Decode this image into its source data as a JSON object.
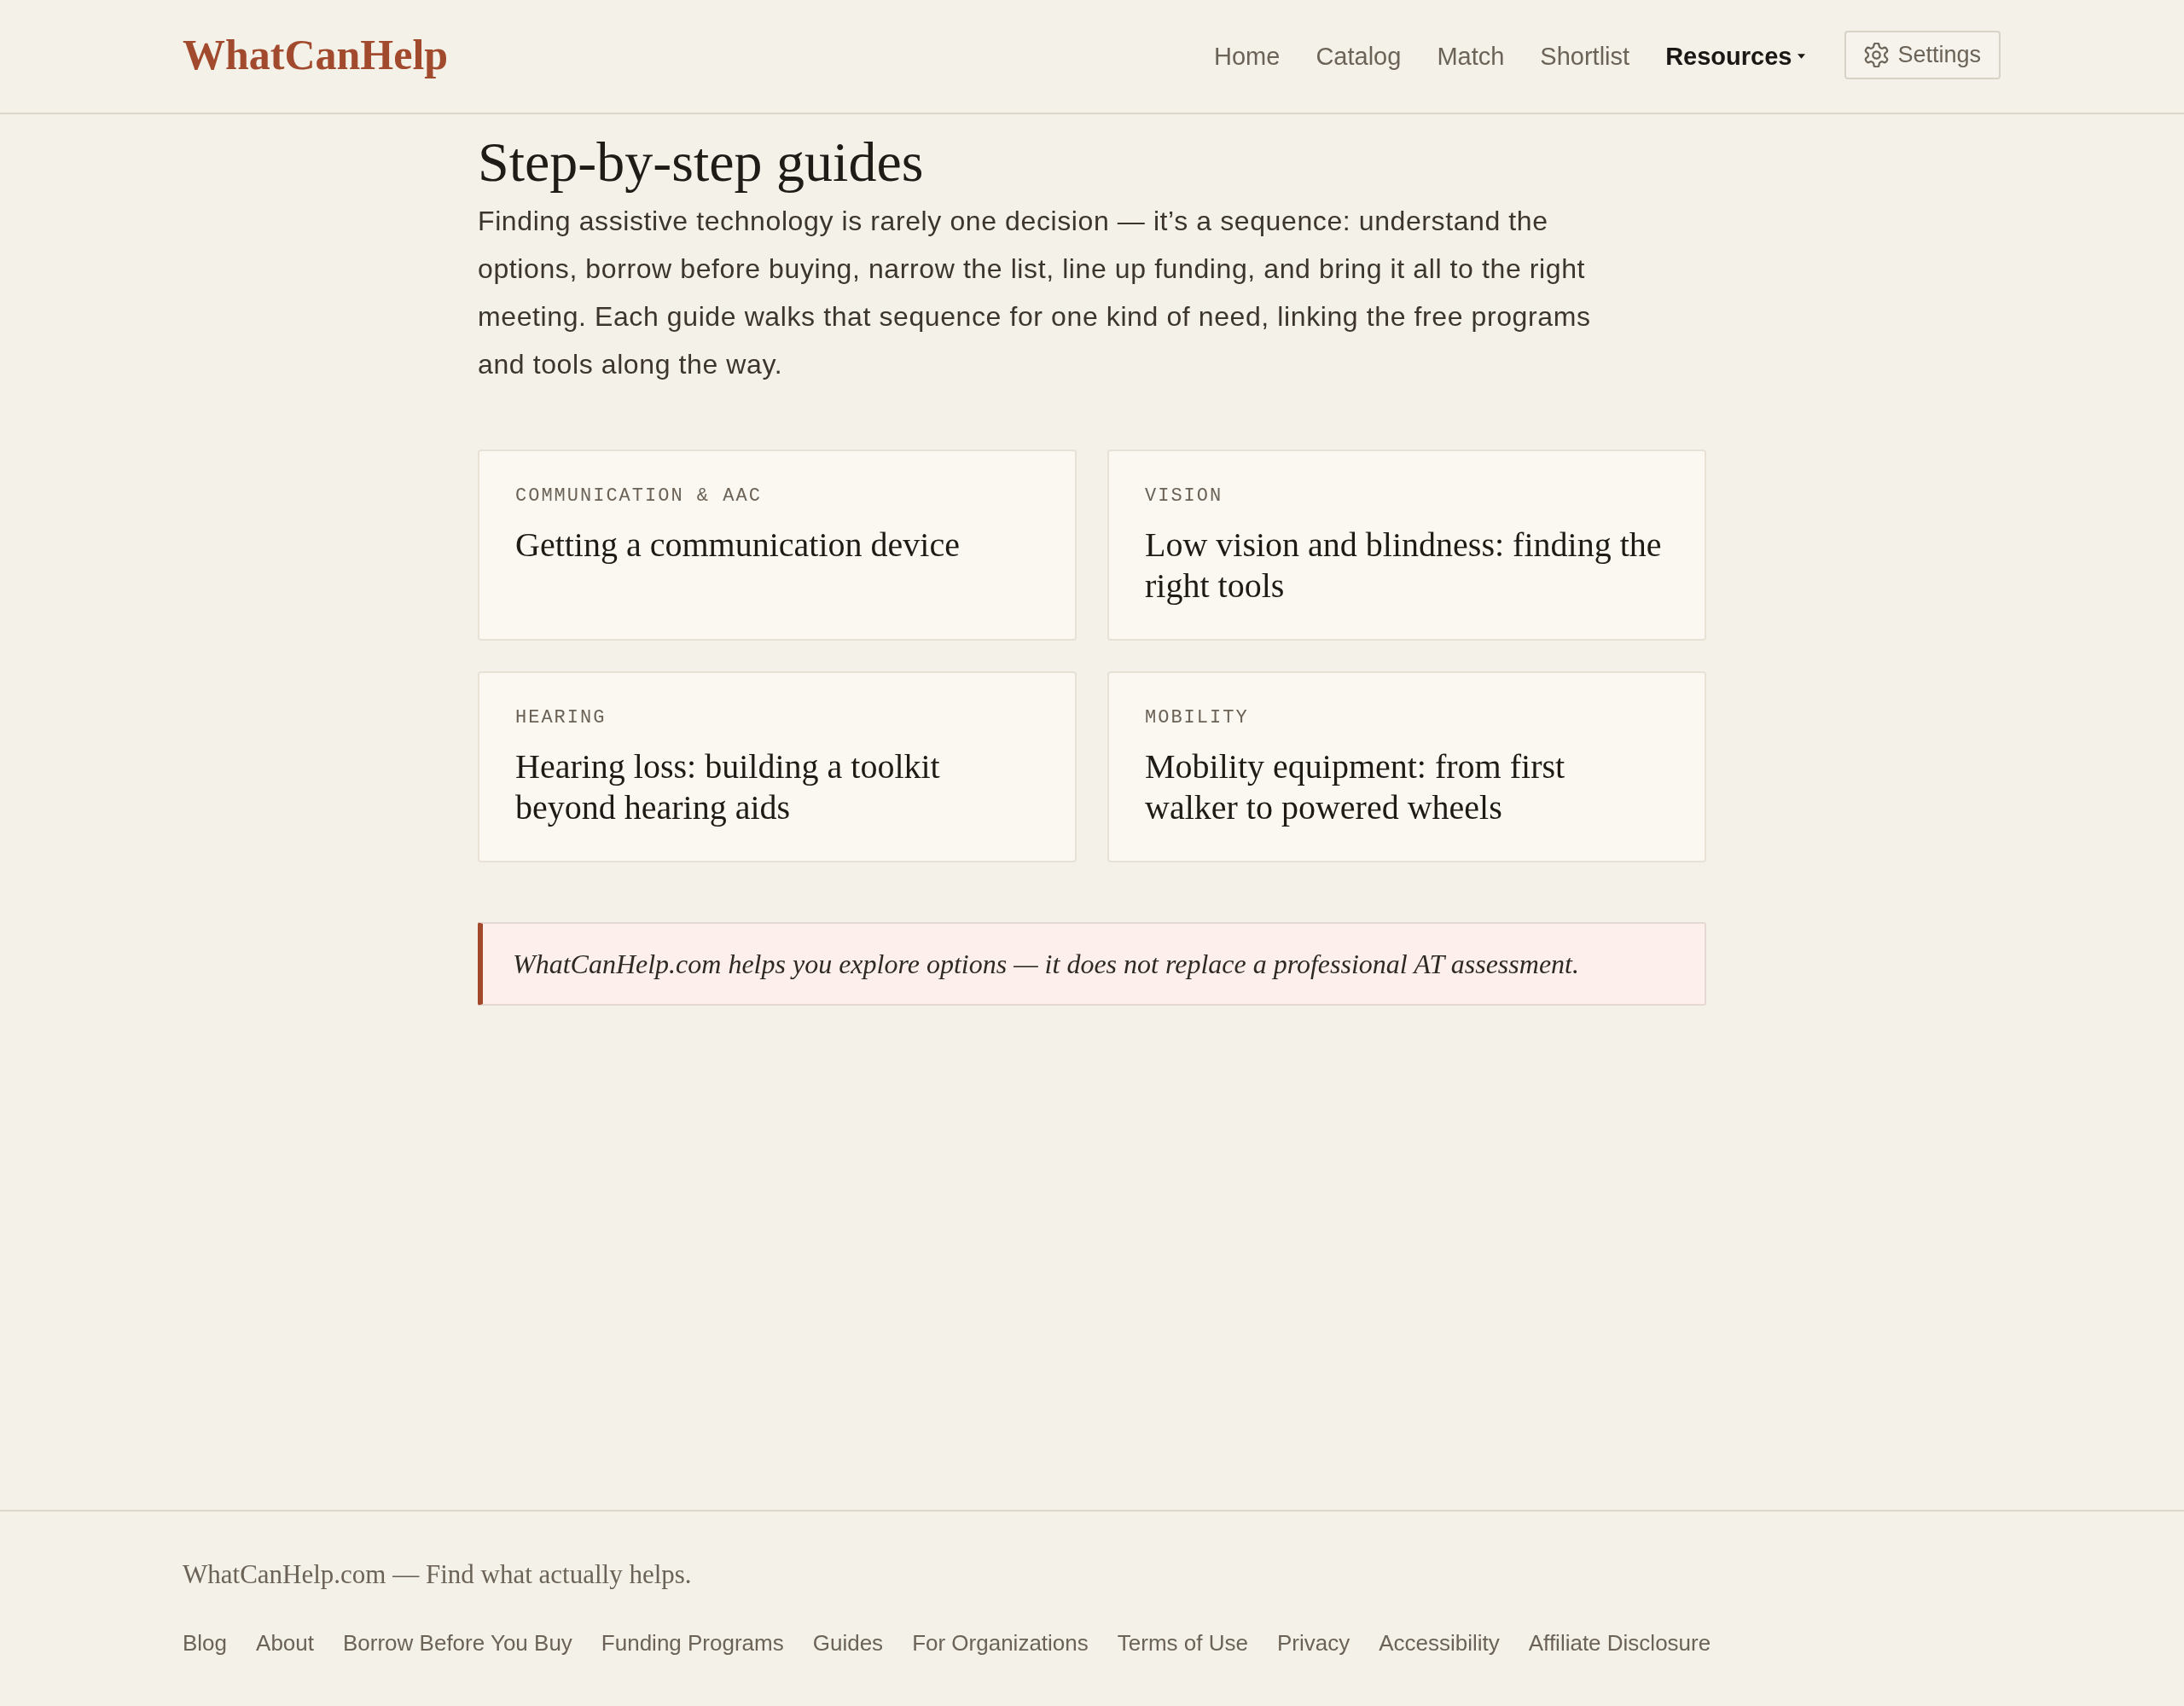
{
  "header": {
    "logo": "WhatCanHelp",
    "nav": [
      {
        "label": "Home",
        "kind": "link",
        "selected": false
      },
      {
        "label": "Catalog",
        "kind": "link",
        "selected": false
      },
      {
        "label": "Match",
        "kind": "link",
        "selected": false
      },
      {
        "label": "Shortlist",
        "kind": "link",
        "selected": false
      },
      {
        "label": "Resources",
        "kind": "menu",
        "selected": true
      }
    ],
    "settings_button": {
      "label": "Settings"
    }
  },
  "page": {
    "title": "Step-by-step guides",
    "intro": "Finding assistive technology is rarely one decision — it’s a sequence: understand the options, borrow before buying, narrow the list, line up funding, and bring it all to the right meeting. Each guide walks that sequence for one kind of need, linking the free programs and tools along the way."
  },
  "guides": [
    {
      "category": "COMMUNICATION & AAC",
      "title": "Getting a communication device"
    },
    {
      "category": "VISION",
      "title": "Low vision and blindness: finding the right tools"
    },
    {
      "category": "HEARING",
      "title": "Hearing loss: building a toolkit beyond hearing aids"
    },
    {
      "category": "MOBILITY",
      "title": "Mobility equipment: from first walker to powered wheels"
    }
  ],
  "disclaimer": "WhatCanHelp.com helps you explore options — it does not replace a professional AT assessment.",
  "footer": {
    "tagline": "WhatCanHelp.com — Find what actually helps.",
    "links": [
      "Blog",
      "About",
      "Borrow Before You Buy",
      "Funding Programs",
      "Guides",
      "For Organizations",
      "Terms of Use",
      "Privacy",
      "Accessibility",
      "Affiliate Disclosure"
    ]
  }
}
